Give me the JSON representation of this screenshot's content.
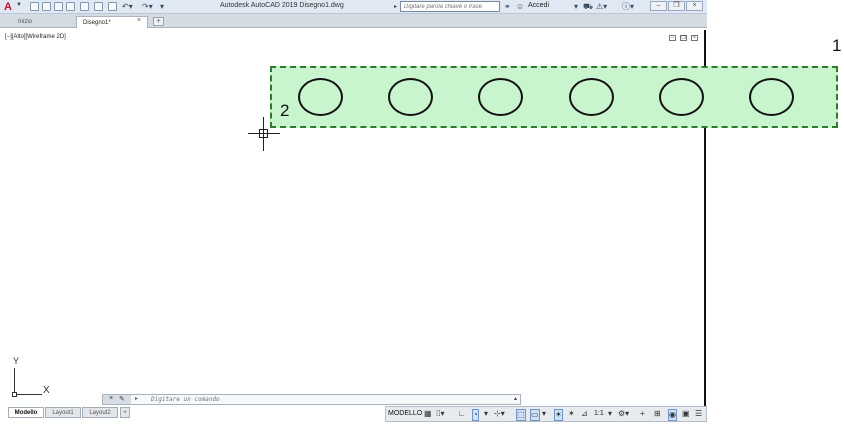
{
  "titlebar": {
    "app_logo": "A",
    "app_logo_icon": "autocad-logo-icon",
    "title": "Autodesk AutoCAD 2019    Disegno1.dwg",
    "search_placeholder": "Digitare parola chiave o frase",
    "sign_in": "Accedi",
    "quick_access_icons": [
      "new-icon",
      "open-icon",
      "save-icon",
      "save-as-icon",
      "print-icon",
      "plot-icon",
      "undo-icon",
      "redo-icon"
    ],
    "window_buttons": [
      "minimize",
      "restore",
      "close"
    ]
  },
  "tabs": {
    "start_label": "Inizio",
    "drawing_label": "Disegno1*",
    "close_glyph": "×",
    "add_glyph": "+"
  },
  "viewport": {
    "label": "[−][Alto][Wireframe 2D]",
    "selection_color": "#c8f5ce",
    "circle_count": 6
  },
  "annotations": {
    "marker_1": "1",
    "marker_2": "2"
  },
  "ucs": {
    "y_label": "Y",
    "x_label": "X"
  },
  "command_line": {
    "placeholder": "Digitare un comando",
    "prompt_glyph": "▸"
  },
  "layout_tabs": {
    "items": [
      "Modello",
      "Layout1",
      "Layout2"
    ],
    "add_glyph": "+"
  },
  "statusbar": {
    "model_label": "MODELLO",
    "scale": "1:1"
  }
}
